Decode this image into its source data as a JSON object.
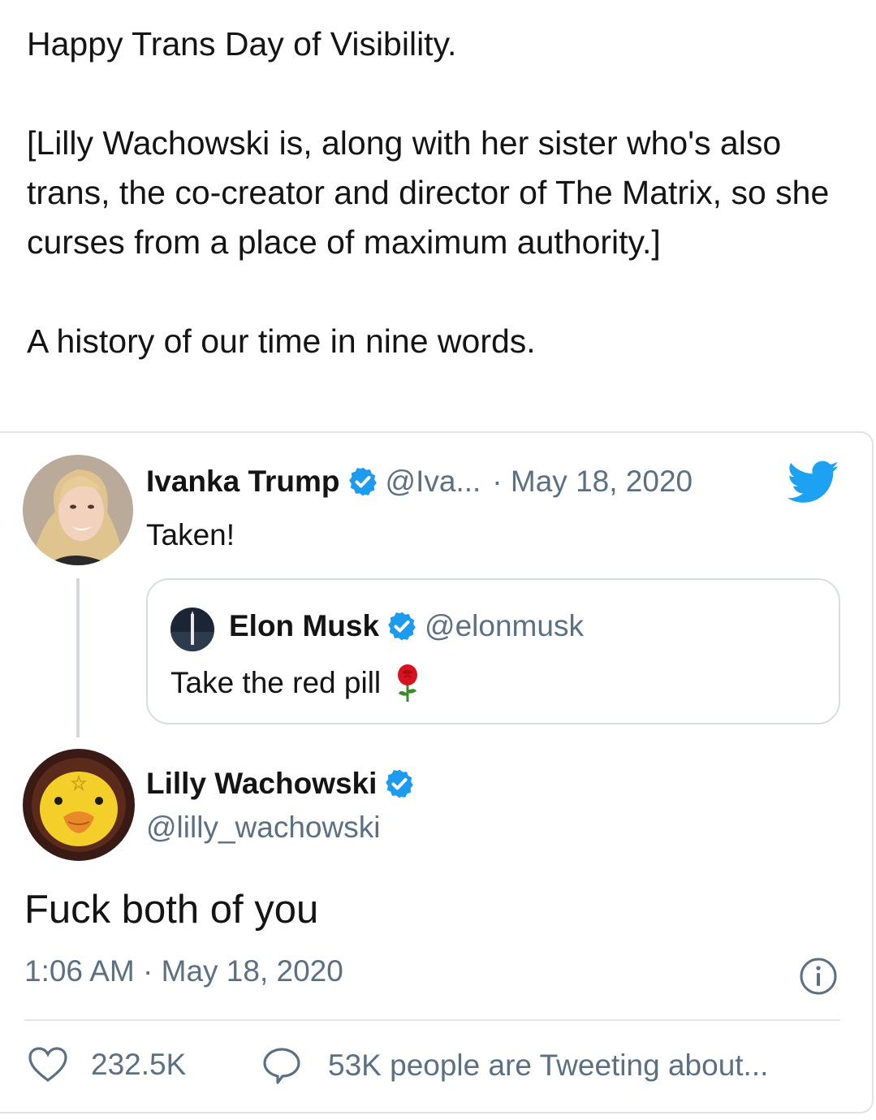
{
  "post": {
    "line1": "Happy Trans Day of Visibility.",
    "paragraph2": "[Lilly Wachowski is, along with her sister who's also trans, the  co-creator and director of The Matrix, so she curses from a place of maximum authority.]",
    "line3": "A history of our time in nine words."
  },
  "embedded_tweet": {
    "parent": {
      "name": "Ivanka Trump",
      "handle": "@Iva...",
      "date": "· May 18, 2020",
      "text": "Taken!"
    },
    "quoted": {
      "name": "Elon Musk",
      "handle": "@elonmusk",
      "text": "Take the red pill",
      "emoji": "rose"
    },
    "reply": {
      "name": "Lilly Wachowski",
      "handle": "@lilly_wachowski",
      "text": "Fuck both of you",
      "timestamp": "1:06 AM · May 18, 2020",
      "likes": "232.5K",
      "tweeting": "53K people are Tweeting about..."
    },
    "icons": [
      "twitter-bird-icon",
      "verified-badge-icon",
      "info-icon",
      "heart-icon",
      "reply-bubble-icon"
    ],
    "colors": {
      "twitter_blue": "#1da1f2",
      "handle_gray": "#5b7083",
      "verified": "#1d9bf0"
    }
  }
}
